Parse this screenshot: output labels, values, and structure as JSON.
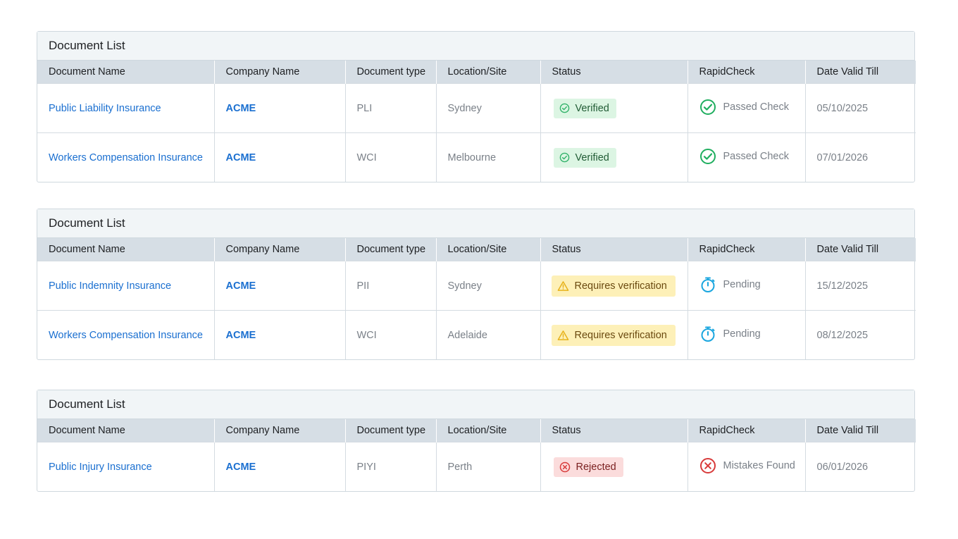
{
  "columns": [
    "Document Name",
    "Company Name",
    "Document type",
    "Location/Site",
    "Status",
    "RapidCheck",
    "Date Valid Till"
  ],
  "colors": {
    "link": "#1a6fd0",
    "verified_bg": "#dcf5e3",
    "verified_icon": "#33b36b",
    "warn_bg": "#fdf0b8",
    "warn_icon": "#e7b21b",
    "rejected_bg": "#fbdcdc",
    "rejected_icon": "#d83a3a",
    "pending_icon": "#1aa6df"
  },
  "panels": [
    {
      "title": "Document List",
      "rows": [
        {
          "document_name": "Public Liability Insurance",
          "company": "ACME",
          "doc_type": "PLI",
          "location": "Sydney",
          "status": "Verified",
          "status_icon": "check-circle-icon",
          "rapidcheck": "Passed Check",
          "rapidcheck_icon": "check-circle-icon",
          "date_valid_till": "05/10/2025"
        },
        {
          "document_name": "Workers Compensation Insurance",
          "company": "ACME",
          "doc_type": "WCI",
          "location": "Melbourne",
          "status": "Verified",
          "status_icon": "check-circle-icon",
          "rapidcheck": "Passed Check",
          "rapidcheck_icon": "check-circle-icon",
          "date_valid_till": "07/01/2026"
        }
      ]
    },
    {
      "title": "Document List",
      "rows": [
        {
          "document_name": "Public Indemnity Insurance",
          "company": "ACME",
          "doc_type": "PII",
          "location": "Sydney",
          "status": "Requires verification",
          "status_icon": "warning-icon",
          "rapidcheck": "Pending",
          "rapidcheck_icon": "stopwatch-icon",
          "date_valid_till": "15/12/2025"
        },
        {
          "document_name": "Workers Compensation Insurance",
          "company": "ACME",
          "doc_type": "WCI",
          "location": "Adelaide",
          "status": "Requires verification",
          "status_icon": "warning-icon",
          "rapidcheck": "Pending",
          "rapidcheck_icon": "stopwatch-icon",
          "date_valid_till": "08/12/2025"
        }
      ]
    },
    {
      "title": "Document List",
      "rows": [
        {
          "document_name": "Public Injury Insurance",
          "company": "ACME",
          "doc_type": "PIYI",
          "location": "Perth",
          "status": "Rejected",
          "status_icon": "x-circle-icon",
          "rapidcheck": "Mistakes Found",
          "rapidcheck_icon": "x-circle-icon",
          "date_valid_till": "06/01/2026"
        }
      ]
    }
  ]
}
